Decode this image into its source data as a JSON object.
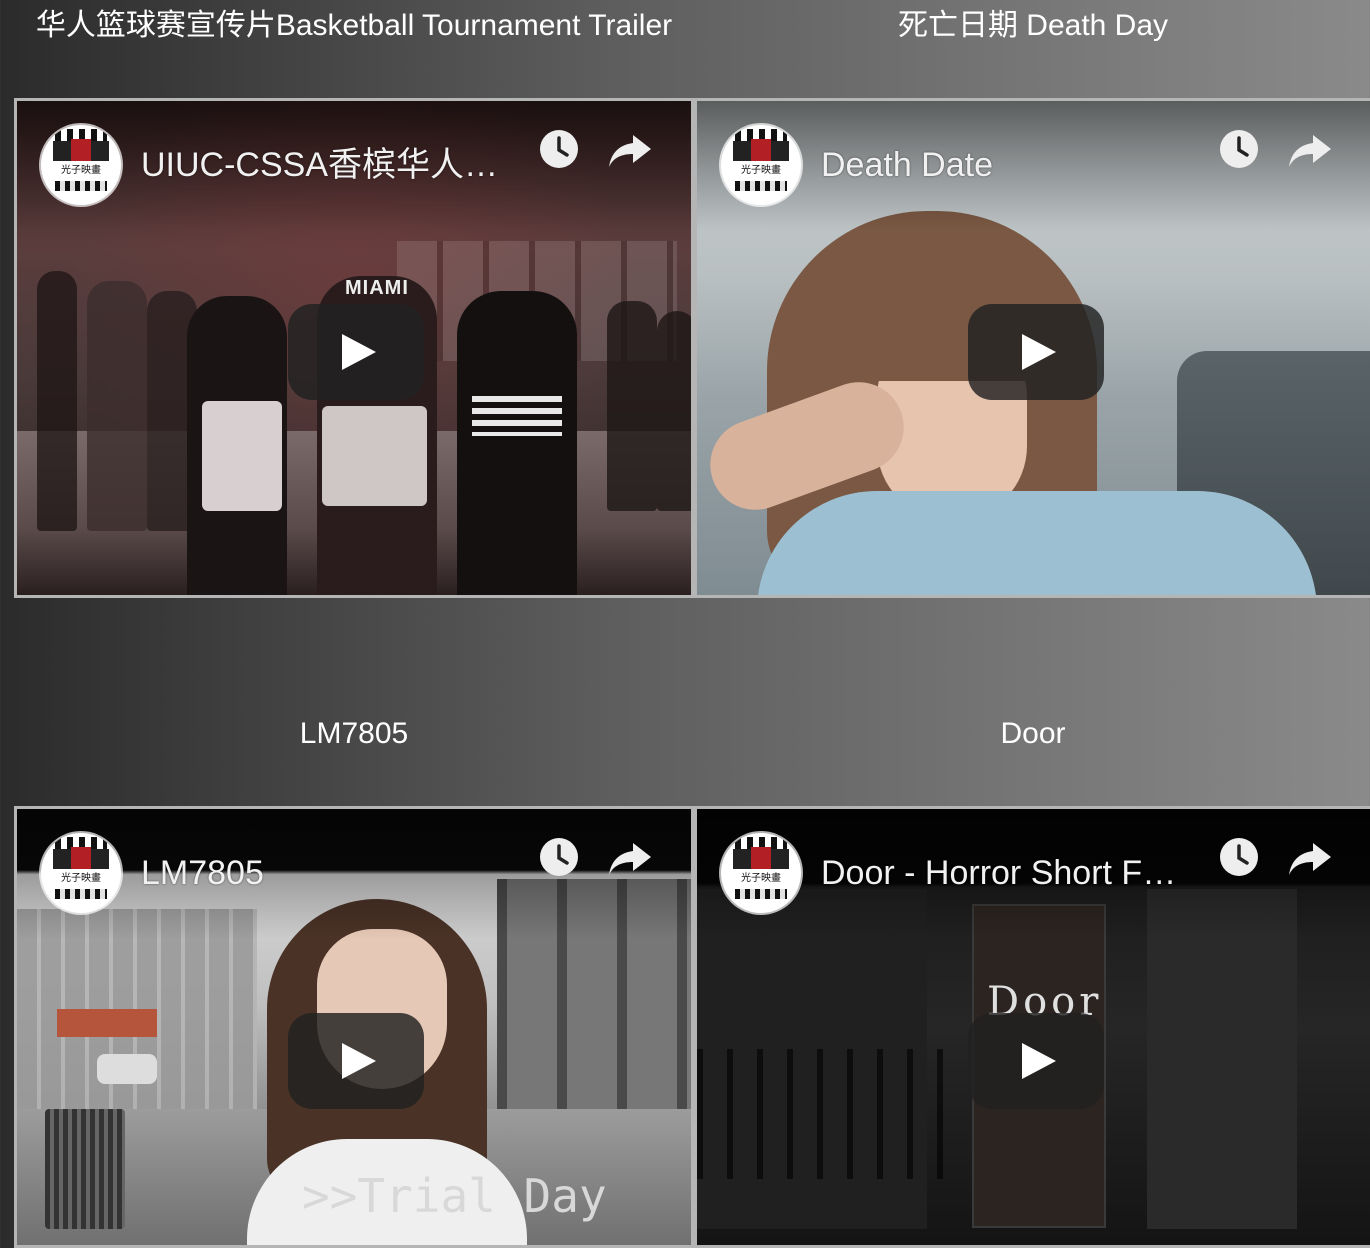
{
  "videos": [
    {
      "caption": "华人篮球赛宣传片Basketball Tournament Trailer",
      "title": "UIUC-CSSA香槟华人…",
      "channel_logo_text": "光子映畫",
      "icons": {
        "watch_later": "clock-icon",
        "share": "share-arrow-icon",
        "play": "play-icon"
      },
      "jersey_text": "MIAMI"
    },
    {
      "caption": "死亡日期 Death Day",
      "title": "Death Date",
      "channel_logo_text": "光子映畫",
      "icons": {
        "watch_later": "clock-icon",
        "share": "share-arrow-icon",
        "play": "play-icon"
      }
    },
    {
      "caption": "LM7805",
      "title": "LM7805",
      "channel_logo_text": "光子映畫",
      "overlay_text": ">>Trial Day",
      "icons": {
        "watch_later": "clock-icon",
        "share": "share-arrow-icon",
        "play": "play-icon"
      }
    },
    {
      "caption": "Door",
      "title": "Door - Horror Short Fil…",
      "channel_logo_text": "光子映畫",
      "overlay_text": "Door",
      "icons": {
        "watch_later": "clock-icon",
        "share": "share-arrow-icon",
        "play": "play-icon"
      }
    }
  ]
}
